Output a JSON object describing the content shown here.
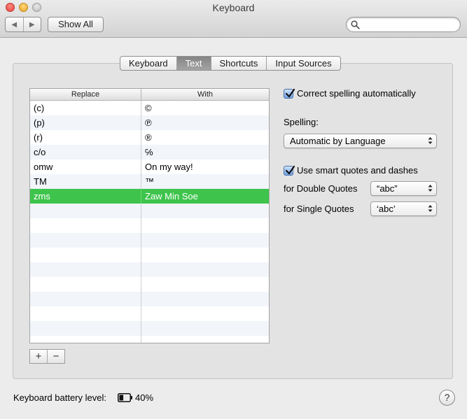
{
  "window": {
    "title": "Keyboard"
  },
  "toolbar": {
    "back_icon": "◀",
    "forward_icon": "▶",
    "show_all_label": "Show All",
    "search_placeholder": ""
  },
  "tabs": [
    {
      "label": "Keyboard",
      "selected": false
    },
    {
      "label": "Text",
      "selected": true
    },
    {
      "label": "Shortcuts",
      "selected": false
    },
    {
      "label": "Input Sources",
      "selected": false
    }
  ],
  "table": {
    "headers": {
      "replace": "Replace",
      "with": "With"
    },
    "rows": [
      {
        "replace": "(c)",
        "with": "©"
      },
      {
        "replace": "(p)",
        "with": "℗"
      },
      {
        "replace": "(r)",
        "with": "®"
      },
      {
        "replace": "c/o",
        "with": "℅"
      },
      {
        "replace": "omw",
        "with": "On my way!"
      },
      {
        "replace": "TM",
        "with": "™"
      },
      {
        "replace": "zms",
        "with": "Zaw Min Soe"
      }
    ],
    "selected_row": 6
  },
  "buttons": {
    "add": "+",
    "remove": "−"
  },
  "options": {
    "correct_spelling": {
      "label": "Correct spelling automatically",
      "checked": true
    },
    "spelling_label": "Spelling:",
    "spelling_value": "Automatic by Language",
    "smart_quotes": {
      "label": "Use smart quotes and dashes",
      "checked": true
    },
    "double_quotes_label": "for Double Quotes",
    "double_quotes_value": "“abc”",
    "single_quotes_label": "for Single Quotes",
    "single_quotes_value": "‘abc’"
  },
  "footer": {
    "battery_label": "Keyboard battery level:",
    "battery_level": "40%",
    "help": "?"
  },
  "colors": {
    "selection": "#3ec44c",
    "selected_tab": "#8f8f8f",
    "checkbox": "#6ea1e6"
  }
}
